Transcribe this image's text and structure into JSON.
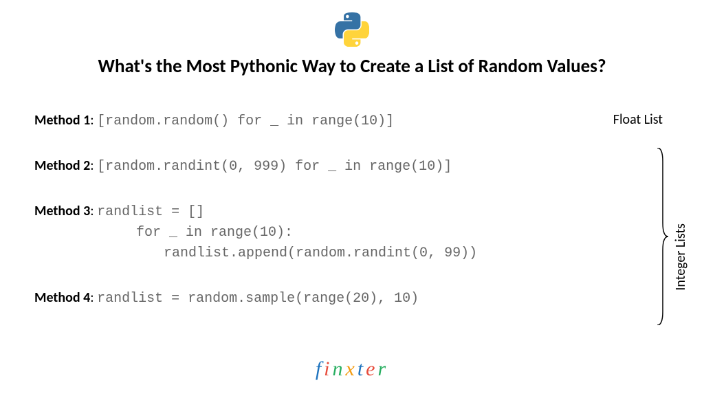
{
  "title": "What's the Most Pythonic Way to Create a List of Random Values?",
  "methods": [
    {
      "label": "Method 1",
      "code": "[random.random() for _ in range(10)]"
    },
    {
      "label": "Method 2",
      "code": "[random.randint(0, 999) for _ in range(10)]"
    },
    {
      "label": "Method 3",
      "code_lines": [
        "randlist = []",
        "for _ in range(10):",
        "    randlist.append(random.randint(0, 99))"
      ]
    },
    {
      "label": "Method 4",
      "code": "randlist = random.sample(range(20), 10)"
    }
  ],
  "annotations": {
    "float_list": "Float List",
    "integer_lists": "Integer Lists"
  },
  "brand": {
    "letters": [
      "f",
      "i",
      "n",
      "x",
      "t",
      "e",
      "r"
    ]
  }
}
